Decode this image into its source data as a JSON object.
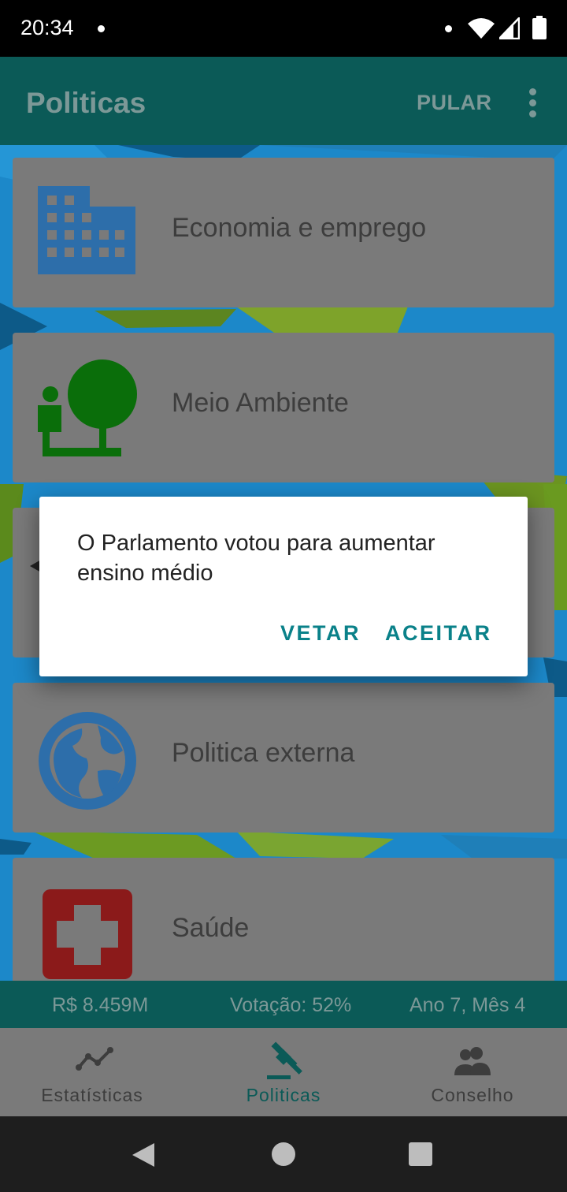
{
  "status_bar": {
    "time": "20:34"
  },
  "app_bar": {
    "title": "Politicas",
    "skip_label": "PULAR",
    "menu_icon": "more-vert-icon"
  },
  "policy_cards": [
    {
      "label": "Economia e emprego",
      "icon": "office-building-icon",
      "icon_color": "#2d6eaa"
    },
    {
      "label": "Meio Ambiente",
      "icon": "person-tree-icon",
      "icon_color": "#0a6e0a"
    },
    {
      "label": "",
      "icon": "hidden-card-icon"
    },
    {
      "label": "Politica externa",
      "icon": "globe-icon",
      "icon_color": "#2d6eaa"
    },
    {
      "label": "Saúde",
      "icon": "medical-cross-icon",
      "icon_color": "#8b1a1a"
    }
  ],
  "info_strip": {
    "money": "R$ 8.459M",
    "vote": "Votação: 52%",
    "date": "Ano 7, Mês 4"
  },
  "bottom_nav": {
    "items": [
      {
        "label": "Estatísticas",
        "icon": "chart-line-icon",
        "active": false
      },
      {
        "label": "Politicas",
        "icon": "gavel-icon",
        "active": true
      },
      {
        "label": "Conselho",
        "icon": "people-icon",
        "active": false
      }
    ]
  },
  "dialog": {
    "message": "O Parlamento votou para aumentar ensino médio",
    "veto_label": "VETAR",
    "accept_label": "ACEITAR"
  },
  "colors": {
    "app_bar": "#0b5a57",
    "accent": "#0a8189",
    "card_overlay": "#7a7a7a"
  }
}
